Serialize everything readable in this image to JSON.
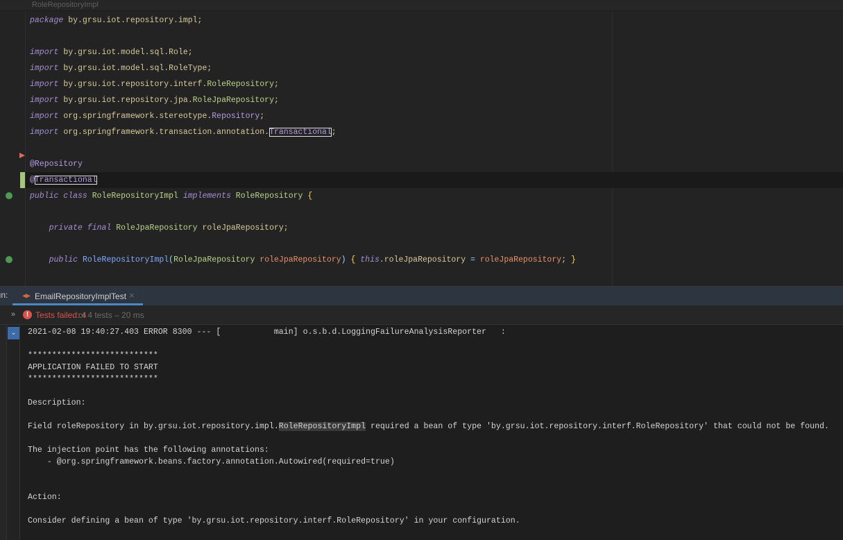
{
  "editor": {
    "file_breadcrumb": "RoleRepositoryImpl",
    "lines": [
      [
        [
          "kw",
          "package"
        ],
        [
          "pk",
          " by.grsu.iot.repository.impl;"
        ]
      ],
      [],
      [
        [
          "kw",
          "import"
        ],
        [
          "pk",
          " by.grsu.iot.model.sql.Role;"
        ]
      ],
      [
        [
          "kw",
          "import"
        ],
        [
          "pk",
          " by.grsu.iot.model.sql.RoleType;"
        ]
      ],
      [
        [
          "kw",
          "import"
        ],
        [
          "pk",
          " by.grsu.iot.repository.interf."
        ],
        [
          "ty",
          "RoleRepository"
        ],
        [
          "pk",
          ";"
        ]
      ],
      [
        [
          "kw",
          "import"
        ],
        [
          "pk",
          " by.grsu.iot.repository.jpa."
        ],
        [
          "ty",
          "RoleJpaRepository"
        ],
        [
          "pk",
          ";"
        ]
      ],
      [
        [
          "kw",
          "import"
        ],
        [
          "pk",
          " org.springframework.stereotype."
        ],
        [
          "an",
          "Repository"
        ],
        [
          "pk",
          ";"
        ]
      ],
      [
        [
          "kw",
          "import"
        ],
        [
          "pk",
          " org.springframework.transaction.annotation."
        ],
        [
          "an box",
          "Transactional"
        ],
        [
          "pk",
          ";"
        ]
      ],
      [],
      [
        [
          "an",
          "@Repository"
        ]
      ],
      [
        [
          "an",
          "@"
        ],
        [
          "an box",
          "Transactional"
        ]
      ],
      [
        [
          "kw",
          "public class"
        ],
        [
          "pk",
          " "
        ],
        [
          "cls",
          "RoleRepositoryImpl"
        ],
        [
          "pk",
          " "
        ],
        [
          "kw",
          "implements"
        ],
        [
          "pk",
          " "
        ],
        [
          "cls",
          "RoleRepository"
        ],
        [
          "pk",
          " "
        ],
        [
          "br",
          "{"
        ]
      ],
      [],
      [
        [
          "pk",
          "    "
        ],
        [
          "kw",
          "private final"
        ],
        [
          "pk",
          " "
        ],
        [
          "cls",
          "RoleJpaRepository"
        ],
        [
          "pk",
          " roleJpaRepository;"
        ]
      ],
      [],
      [
        [
          "pk",
          "    "
        ],
        [
          "kw",
          "public"
        ],
        [
          "pk",
          " "
        ],
        [
          "fn",
          "RoleRepositoryImpl"
        ],
        [
          "pu",
          "("
        ],
        [
          "cls",
          "RoleJpaRepository"
        ],
        [
          "pk",
          " "
        ],
        [
          "pa",
          "roleJpaRepository"
        ],
        [
          "pu",
          ")"
        ],
        [
          "pk",
          " "
        ],
        [
          "br",
          "{"
        ],
        [
          "pk",
          " "
        ],
        [
          "kw",
          "this"
        ],
        [
          "pk",
          ".roleJpaRepository "
        ],
        [
          "pu",
          "="
        ],
        [
          "pk",
          " "
        ],
        [
          "pa",
          "roleJpaRepository"
        ],
        [
          "pk",
          "; "
        ],
        [
          "br",
          "}"
        ]
      ]
    ]
  },
  "run_panel": {
    "label": "Run:",
    "tab_label": "EmailRepositoryImplTest",
    "status_failed": "Tests failed: 4",
    "status_rest": "of 4 tests – 20 ms",
    "colors": {
      "error": "#d9534f",
      "accent": "#4a88c7"
    }
  },
  "console": [
    {
      "text": "2021-02-08 19:40:27.403 ERROR 8300 --- [           main] o.s.b.d.LoggingFailureAnalysisReporter   :"
    },
    {
      "text": ""
    },
    {
      "text": "***************************"
    },
    {
      "text": "APPLICATION FAILED TO START"
    },
    {
      "text": "***************************"
    },
    {
      "text": ""
    },
    {
      "text": "Description:"
    },
    {
      "text": ""
    },
    {
      "pre": "Field roleRepository in by.grsu.iot.repository.impl.",
      "hl": "RoleRepositoryImpl",
      "post": " required a bean of type 'by.grsu.iot.repository.interf.RoleRepository' that could not be found."
    },
    {
      "text": ""
    },
    {
      "text": "The injection point has the following annotations:"
    },
    {
      "text": "\t- @org.springframework.beans.factory.annotation.Autowired(required=true)"
    },
    {
      "text": ""
    },
    {
      "text": ""
    },
    {
      "text": "Action:"
    },
    {
      "text": ""
    },
    {
      "text": "Consider defining a bean of type 'by.grsu.iot.repository.interf.RoleRepository' in your configuration."
    }
  ]
}
